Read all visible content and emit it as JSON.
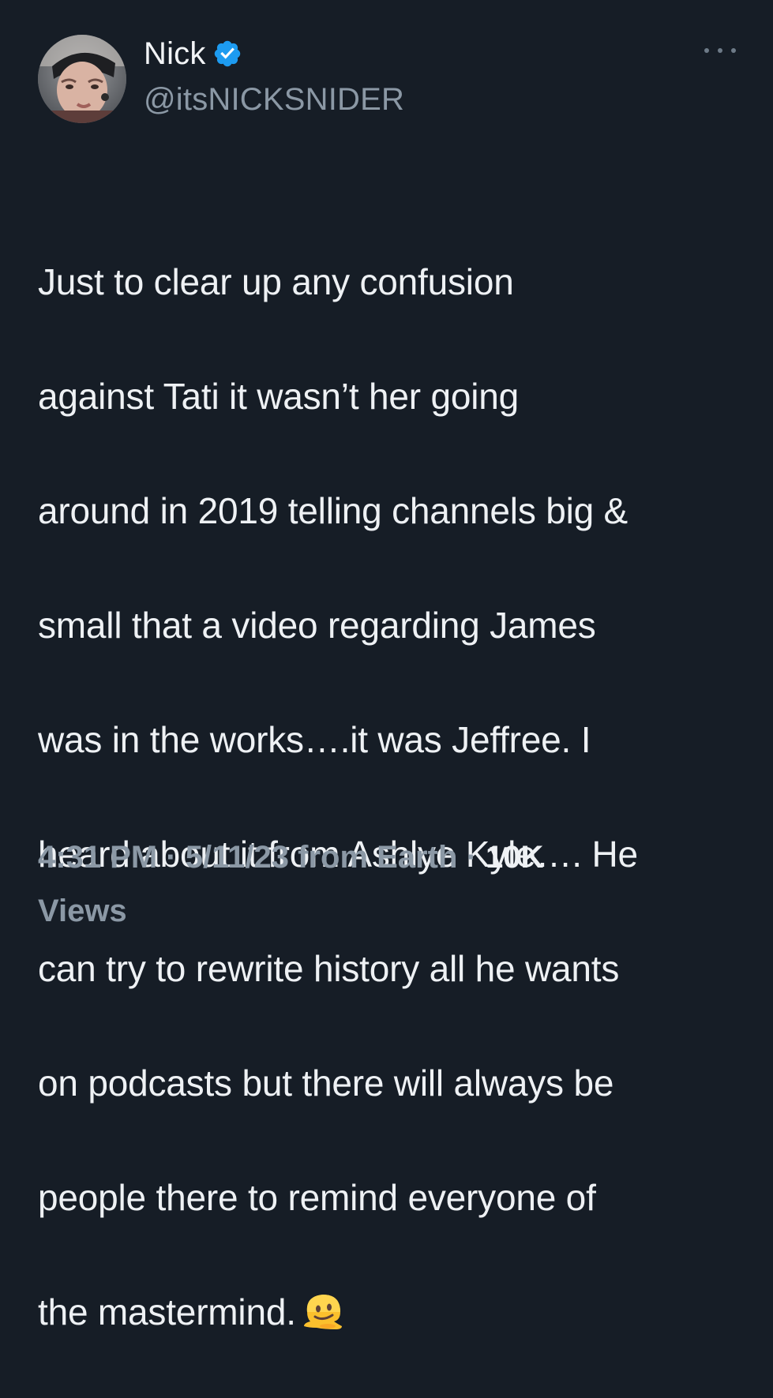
{
  "tweet": {
    "author": {
      "display_name": "Nick",
      "handle": "@itsNICKSNIDER",
      "verified": true,
      "verified_icon": "verified-badge-icon",
      "avatar": "profile-photo"
    },
    "more_icon": "more-options-icon",
    "text_lines": [
      "Just to clear up any confusion",
      "against Tati it wasn’t her going",
      "around in 2019 telling channels big &",
      "small that a video regarding James",
      "was in the works….it was Jeffree. I",
      "heard about it from Ashlye Kyle…. He",
      "can try to rewrite history all he wants",
      "on podcasts but there will always be",
      "people there to remind everyone of",
      "the mastermind."
    ],
    "emoji": "melting-face-emoji",
    "time": "4:31 PM",
    "date": "5/11/23",
    "source": "from Earth",
    "views_count": "10K",
    "views_label": "Views",
    "separator": "·"
  },
  "colors": {
    "background": "#161d26",
    "text": "#eef1f4",
    "muted": "#8b98a5",
    "verified_blue": "#1d9bf0"
  }
}
